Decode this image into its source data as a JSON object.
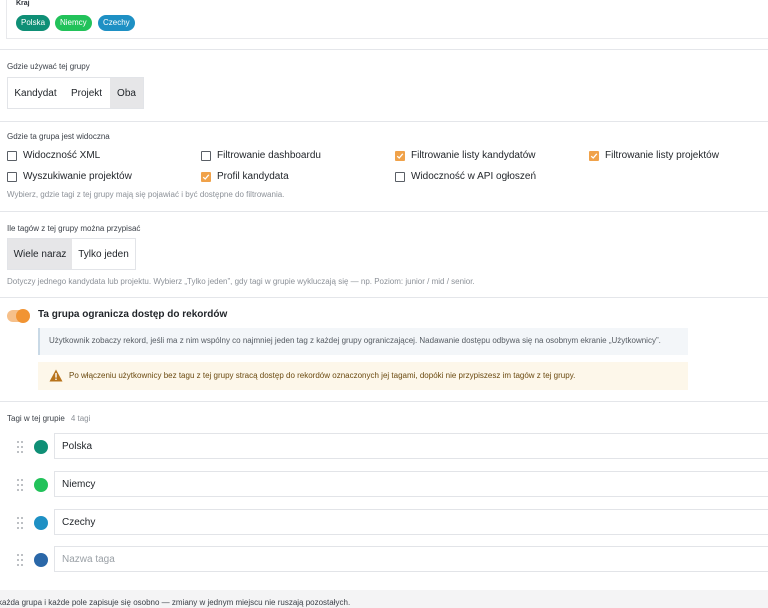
{
  "kraj": {
    "label": "Kraj",
    "chips": [
      {
        "label": "Polska",
        "color": "#0f8f76"
      },
      {
        "label": "Niemcy",
        "color": "#22c25a"
      },
      {
        "label": "Czechy",
        "color": "#1e90c4"
      }
    ]
  },
  "usage": {
    "label": "Gdzie używać tej grupy",
    "options": [
      "Kandydat",
      "Projekt",
      "Oba"
    ],
    "selected": "Oba"
  },
  "visibility": {
    "label": "Gdzie ta grupa jest widoczna",
    "items": [
      {
        "label": "Widoczność XML",
        "checked": false
      },
      {
        "label": "Filtrowanie dashboardu",
        "checked": false
      },
      {
        "label": "Filtrowanie listy kandydatów",
        "checked": true
      },
      {
        "label": "Filtrowanie listy projektów",
        "checked": true
      },
      {
        "label": "Wyszukiwanie projektów",
        "checked": false
      },
      {
        "label": "Profil kandydata",
        "checked": true
      },
      {
        "label": "Widoczność w API ogłoszeń",
        "checked": false
      }
    ],
    "hint": "Wybierz, gdzie tagi z tej grupy mają się pojawiać i być dostępne do filtrowania."
  },
  "multiplicity": {
    "label": "Ile tagów z tej grupy można przypisać",
    "options": [
      "Wiele naraz",
      "Tylko jeden"
    ],
    "selected": "Wiele naraz",
    "hint": "Dotyczy jednego kandydata lub projektu. Wybierz „Tylko jeden”, gdy tagi w grupie wykluczają się — np. Poziom: junior / mid / senior."
  },
  "restrict": {
    "label": "Ta grupa ogranicza dostęp do rekordów",
    "enabled": true,
    "info": "Użytkownik zobaczy rekord, jeśli ma z nim wspólny co najmniej jeden tag z każdej grupy ograniczającej. Nadawanie dostępu odbywa się na osobnym ekranie „Użytkownicy”.",
    "warning": "Po włączeniu użytkownicy bez tagu z tej grupy stracą dostęp do rekordów oznaczonych jej tagami, dopóki nie przypiszesz im tagów z tej grupy."
  },
  "tags": {
    "label": "Tagi w tej grupie",
    "count": "4 tagi",
    "items": [
      {
        "name": "Polska",
        "color": "#0f8f76"
      },
      {
        "name": "Niemcy",
        "color": "#22c25a"
      },
      {
        "name": "Czechy",
        "color": "#1e90c4"
      }
    ],
    "new_color": "#2a67a8",
    "new_placeholder": "Nazwa taga"
  },
  "footer": "każda grupa i każde pole zapisuje się osobno — zmiany w jednym miejscu nie ruszają pozostałych.",
  "colors": {
    "accent": "#f19433"
  }
}
